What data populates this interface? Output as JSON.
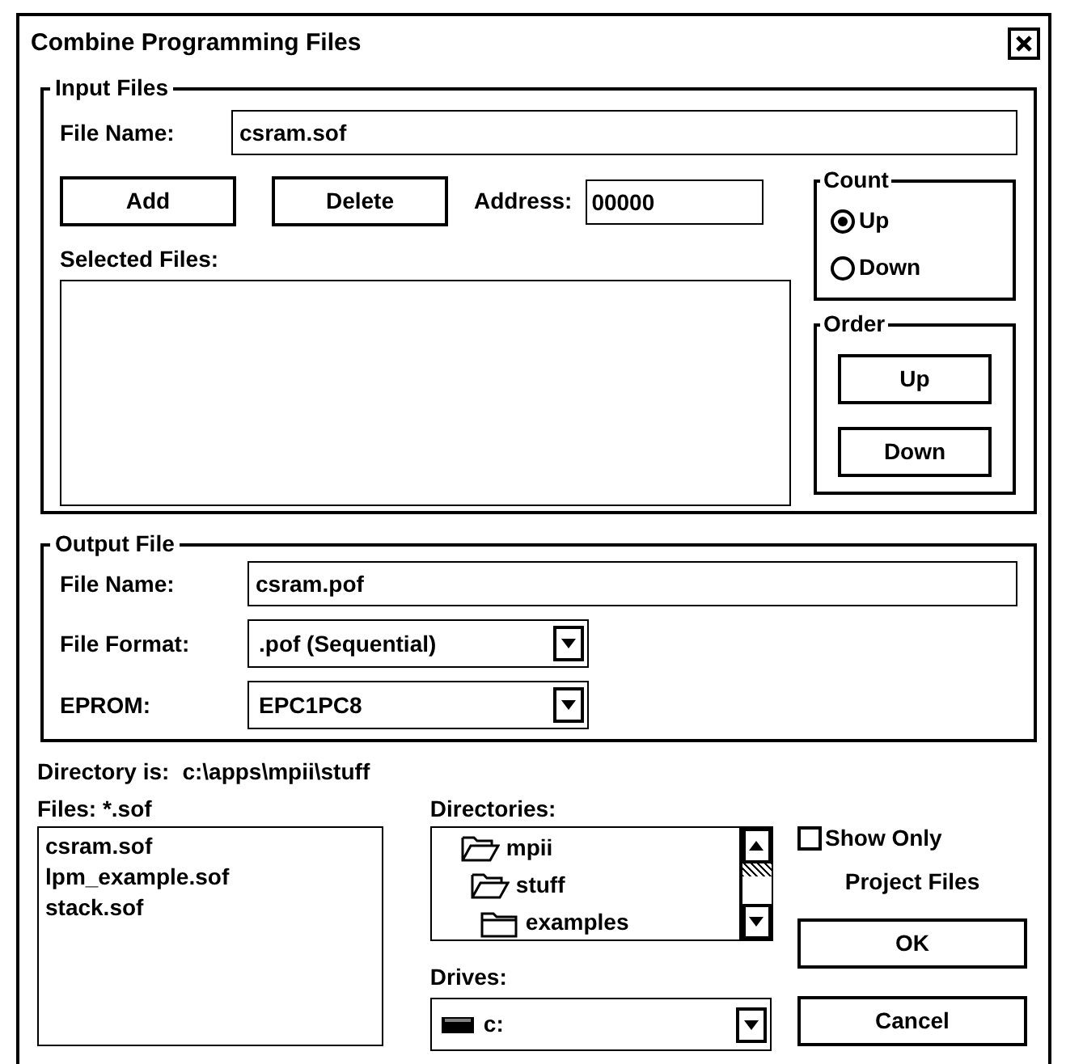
{
  "window": {
    "title": "Combine Programming Files"
  },
  "input_files": {
    "legend": "Input Files",
    "file_name": {
      "label": "File Name:",
      "value": "csram.sof"
    },
    "buttons": [
      "Add",
      "Delete"
    ],
    "address": {
      "label": "Address:",
      "value": "00000"
    },
    "selected_files": {
      "label": "Selected Files:"
    },
    "count": {
      "legend": "Count",
      "options": [
        {
          "label": "Up",
          "selected": true
        },
        {
          "label": "Down",
          "selected": false
        }
      ]
    },
    "order": {
      "legend": "Order",
      "buttons": [
        "Up",
        "Down"
      ]
    }
  },
  "output_file": {
    "legend": "Output File",
    "file_name": {
      "label": "File Name:",
      "value": "csram.pof"
    },
    "file_format": {
      "label": "File Format:",
      "value": ".pof (Sequential)"
    },
    "eprom": {
      "label": "EPROM:",
      "value": "EPC1PC8"
    }
  },
  "directory": {
    "label": "Directory is:",
    "path": "c:\\apps\\mpii\\stuff"
  },
  "files": {
    "label": "Files: *.sof",
    "items": [
      "csram.sof",
      "lpm_example.sof",
      "stack.sof"
    ]
  },
  "directories": {
    "label": "Directories:",
    "items": [
      {
        "name": "mpii",
        "expanded": true,
        "children": [
          {
            "name": "stuff",
            "expanded": true,
            "children": [
              {
                "name": "examples",
                "expanded": false
              }
            ]
          }
        ]
      }
    ]
  },
  "drives": {
    "label": "Drives:",
    "value": "c:"
  },
  "show_only": {
    "lines": [
      "Show Only",
      "Project Files"
    ],
    "checked": false
  },
  "buttons": [
    "OK",
    "Cancel"
  ]
}
